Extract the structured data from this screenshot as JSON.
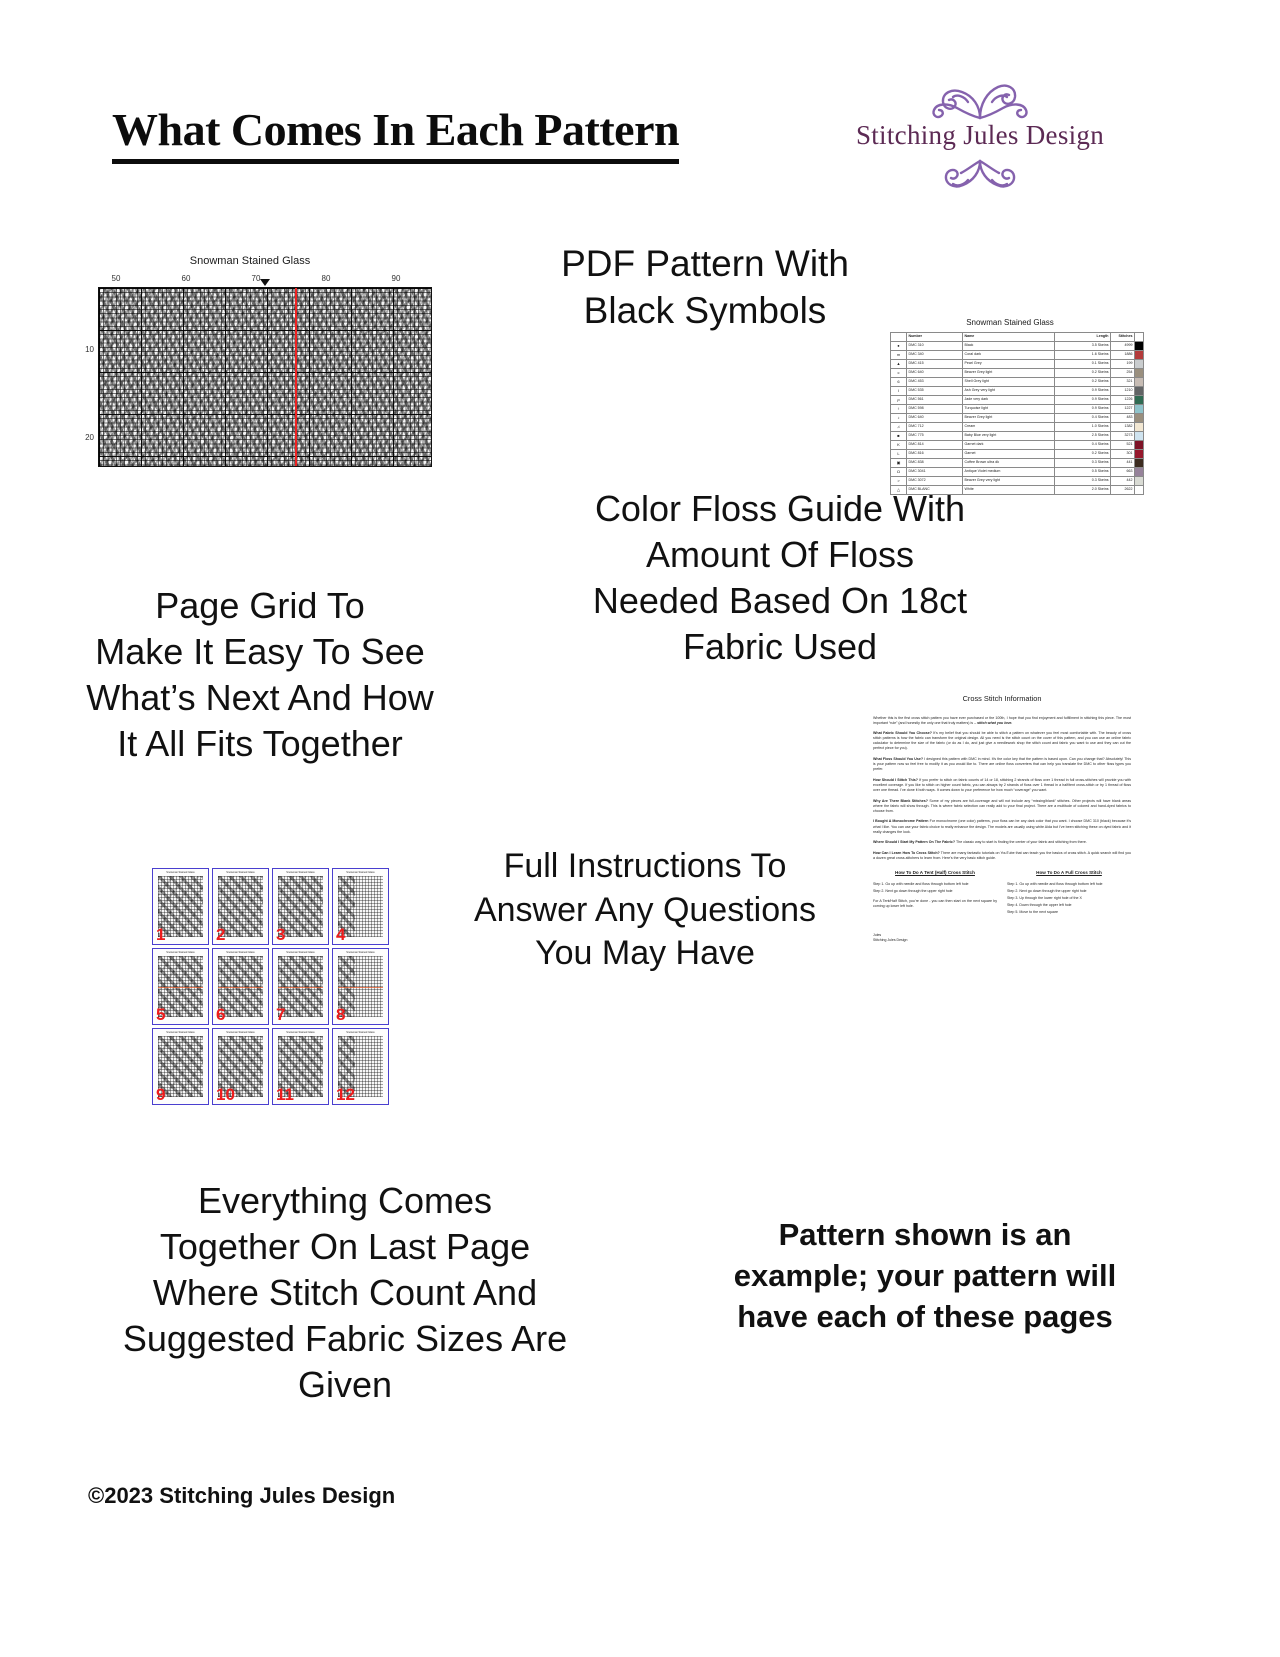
{
  "header": {
    "title": "What Comes In Each Pattern",
    "logo": {
      "wordmark": "Stitching Jules Design",
      "flourish_top": "❦ ❧ ❀ ❧ ❦",
      "flourish_bottom": "❦ ❧ ❀ ❧ ❦",
      "accent_color": "#8562ad",
      "text_color": "#5c2a54"
    }
  },
  "callouts": {
    "pdf_pattern": "PDF Pattern With\nBlack Symbols",
    "floss_guide": "Color Floss Guide With\nAmount Of Floss\nNeeded Based On 18ct\nFabric Used",
    "page_grid": "Page Grid To\nMake It Easy To See\nWhat’s Next And How\nIt All Fits Together",
    "full_instructions": "Full Instructions To\nAnswer Any Questions\nYou May Have",
    "everything_comes": "Everything Comes\nTogether On Last Page\nWhere Stitch Count And\nSuggested Fabric Sizes Are\nGiven",
    "example_note": "Pattern shown is an example; your pattern will have each of these pages"
  },
  "footer": {
    "copyright": "©2023 Stitching Jules Design"
  },
  "chart_preview": {
    "title": "Snowman Stained Glass",
    "column_labels": [
      "50",
      "60",
      "70",
      "80",
      "90"
    ],
    "row_labels": [
      "10",
      "20"
    ],
    "center_line_color": "#ee2222"
  },
  "floss_guide": {
    "title": "Snowman Stained Glass",
    "columns": [
      "",
      "Number",
      "Name",
      "Length",
      "Stitches",
      ""
    ],
    "rows": [
      {
        "symbol": "●",
        "number": "DMC   310",
        "name": "Black",
        "length": "3.5 Skeins",
        "stitches": "4999",
        "swatch": "#000000"
      },
      {
        "symbol": "m",
        "number": "DMC   340",
        "name": "Coral dark",
        "length": "1.6 Skeins",
        "stitches": "1886",
        "swatch": "#b43a3a"
      },
      {
        "symbol": "▲",
        "number": "DMC   415",
        "name": "Pearl Grey",
        "length": "0.1 Skeins",
        "stitches": "199",
        "swatch": "#c9ccce"
      },
      {
        "symbol": "c",
        "number": "DMC   640",
        "name": "Beaver Grey light",
        "length": "0.2 Skeins",
        "stitches": "254",
        "swatch": "#9a8f7e"
      },
      {
        "symbol": "6",
        "number": "DMC   453",
        "name": "Shell Grey light",
        "length": "0.2 Skeins",
        "stitches": "321",
        "swatch": "#c7bcb4"
      },
      {
        "symbol": "I",
        "number": "DMC   535",
        "name": "Ash Grey very light",
        "length": "0.9 Skeins",
        "stitches": "1210",
        "swatch": "#626465"
      },
      {
        "symbol": "ρ",
        "number": "DMC   561",
        "name": "Jade very dark",
        "length": "0.9 Skeins",
        "stitches": "1226",
        "swatch": "#2f6b52"
      },
      {
        "symbol": "♀",
        "number": "DMC   598",
        "name": "Turquoise light",
        "length": "0.9 Skeins",
        "stitches": "1227",
        "swatch": "#8fc4cb"
      },
      {
        "symbol": "♪",
        "number": "DMC   640",
        "name": "Beaver Grey light",
        "length": "0.4 Skeins",
        "stitches": "483",
        "swatch": "#9a8f7e"
      },
      {
        "symbol": "♫",
        "number": "DMC   712",
        "name": "Cream",
        "length": "1.0 Skeins",
        "stitches": "1382",
        "swatch": "#f2e7d2"
      },
      {
        "symbol": "■",
        "number": "DMC   775",
        "name": "Baby Blue very light",
        "length": "2.5 Skeins",
        "stitches": "3273",
        "swatch": "#cfe3ef"
      },
      {
        "symbol": "K",
        "number": "DMC   814",
        "name": "Garnet dark",
        "length": "0.4 Skeins",
        "stitches": "521",
        "swatch": "#7e1226"
      },
      {
        "symbol": "L",
        "number": "DMC   816",
        "name": "Garnet",
        "length": "0.2 Skeins",
        "stitches": "301",
        "swatch": "#96182c"
      },
      {
        "symbol": "▣",
        "number": "DMC   838",
        "name": "Coffee Brown ultra dk",
        "length": "0.3 Skeins",
        "stitches": "441",
        "swatch": "#3c2b1f"
      },
      {
        "symbol": "Ω",
        "number": "DMC   3041",
        "name": "Antique Violet medium",
        "length": "0.5 Skeins",
        "stitches": "663",
        "swatch": "#96829a"
      },
      {
        "symbol": ">",
        "number": "DMC   3072",
        "name": "Beaver Grey very light",
        "length": "0.3 Skeins",
        "stitches": "442",
        "swatch": "#d9dbd4"
      },
      {
        "symbol": "△",
        "number": "DMC   BLANC",
        "name": "White",
        "length": "2.0 Skeins",
        "stitches": "2622",
        "swatch": "#ffffff"
      }
    ]
  },
  "page_grid": {
    "title": "Snowman Stained Glass",
    "page_numbers": [
      "1",
      "2",
      "3",
      "4",
      "5",
      "6",
      "7",
      "8",
      "9",
      "10",
      "11",
      "12"
    ],
    "border_color": "#4a3fcf",
    "number_color": "#ee1c1c"
  },
  "instructions_doc": {
    "title": "Cross Stitch Information",
    "paragraphs": [
      {
        "lead": "",
        "text": "Whether this is the first cross stitch pattern you have ever purchased or the 100th, I hope that you find enjoyment and fulfillment in stitching this piece. The most important “rule” (and honestly the only one that truly matters) is – ",
        "emph": "stitch what you love."
      },
      {
        "lead": "What Fabric Should You Choose?",
        "text": " It’s my belief that you should be able to stitch a pattern on whatever you feel most comfortable with. The beauty of cross stitch patterns is how the fabric can transform the original design. All you need is the stitch count on the cover of this pattern, and you can use an online fabric calculator to determine the size of the fabric (or do as I do, and just give a needlework shop the stitch count and fabric you want to use and they can cut the perfect piece for you).",
        "emph": ""
      },
      {
        "lead": "What Floss Should You Use?",
        "text": " I designed this pattern with DMC in mind. It’s the color key that the pattern is based upon. Can you change that? Absolutely! This is your pattern now so feel free to modify it as you would like to. There are online floss converters that can help you translate the DMC to other floss types you prefer.",
        "emph": ""
      },
      {
        "lead": "How Should I Stitch This?",
        "text": " If you prefer to stitch on fabric counts of 14 or 18, stitching 2 strands of floss over 1 thread in full cross-stitches will provide you with excellent coverage. If you like to stitch on higher count fabric, you can always try 2 strands of floss over 1 thread in a half/tent cross-stitch or try 1 thread of floss over one thread. I’ve done it both ways. It comes down to your preference for how much “coverage” you want.",
        "emph": ""
      },
      {
        "lead": "Why Are There Blank Stitches?",
        "text": " Some of my pieces are full-coverage and will not include any “missing/blank” stitches. Other projects will have blank areas where the fabric will show through. This is where fabric selection can really add to your final project. There are a multitude of colored and hand-dyed fabrics to choose from.",
        "emph": ""
      },
      {
        "lead": "I Bought A Monochrome Pattern",
        "text": " For monochrome (one color) patterns, your floss can be any dark color that you want. I choose DMC 310 (black) because it’s what I like. You can use your fabric choice to really enhance the design. The models are usually using white Aida but I’ve been stitching these on dyed fabric and it really changes the look.",
        "emph": ""
      },
      {
        "lead": "Where Should I Start My Pattern On The Fabric?",
        "text": " The classic way to start is finding the center of your fabric and stitching from there.",
        "emph": ""
      },
      {
        "lead": "How Can I Learn How To Cross Stitch?",
        "text": " There are many fantastic tutorials on YouTube that can teach you the basics of cross stitch. A quick search will find you a dozen great cross-stitchers to learn from. Here’s the very basic stitch guide.",
        "emph": ""
      }
    ],
    "how_to_tent": {
      "heading": "How To Do A Tent (Half) Cross Stitch",
      "steps": [
        "Step 1. Go up with needle and floss through bottom left hole",
        "Step 2. Next go down through the upper right hole"
      ],
      "note": "For A Tent/Half Stitch, you’re done - you can then start on the next square by coming up lower left hole."
    },
    "how_to_full": {
      "heading": "How To Do A Full Cross Stitch",
      "steps": [
        "Step 1. Go up with needle and floss through bottom left hole",
        "Step 2. Next go down through the upper right hole",
        "Step 3. Up through the lower right hole of the X",
        "Step 4. Down through the upper left hole",
        "Step 5. Move to the next square"
      ],
      "note": ""
    },
    "signature": "Jules\nStitching Jules Design"
  }
}
